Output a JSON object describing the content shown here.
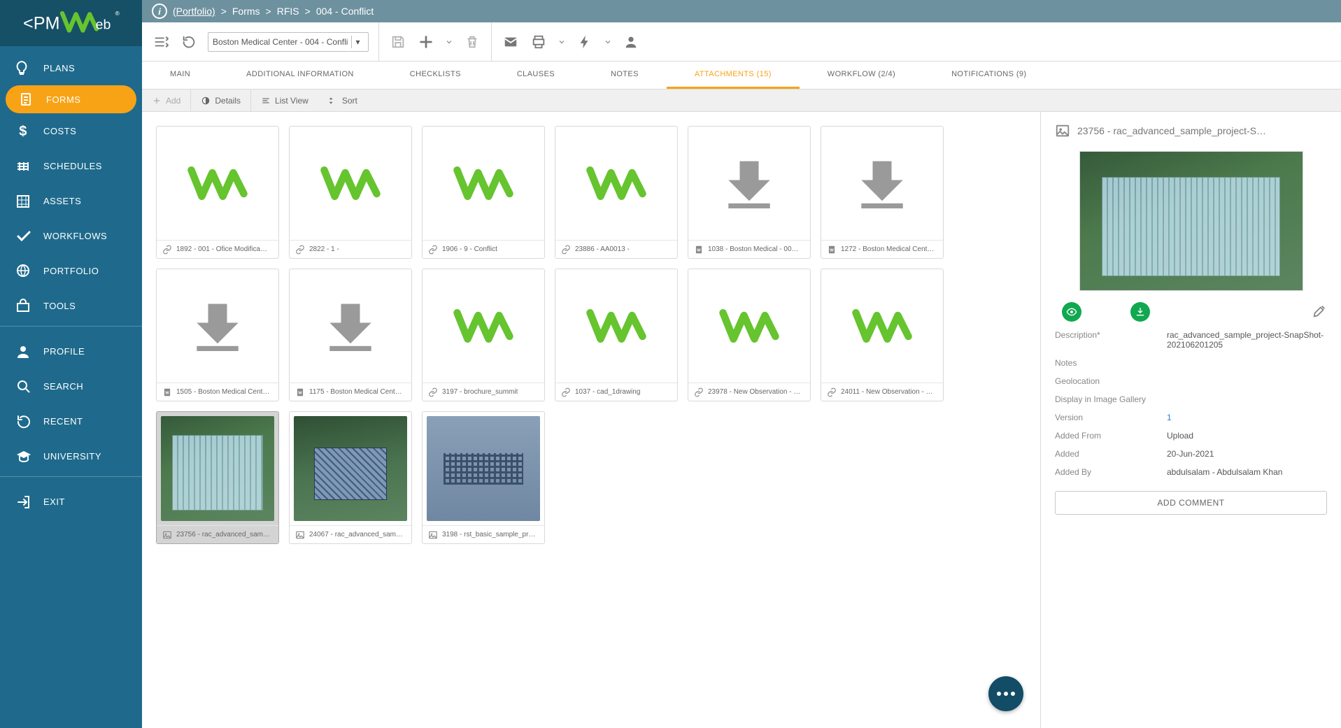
{
  "breadcrumb": {
    "root": "(Portfolio)",
    "p1": "Forms",
    "p2": "RFIS",
    "p3": "004 - Conflict"
  },
  "record_select": "Boston Medical Center - 004 - Confli",
  "nav": [
    {
      "label": "PLANS"
    },
    {
      "label": "FORMS",
      "active": true
    },
    {
      "label": "COSTS"
    },
    {
      "label": "SCHEDULES"
    },
    {
      "label": "ASSETS"
    },
    {
      "label": "WORKFLOWS"
    },
    {
      "label": "PORTFOLIO"
    },
    {
      "label": "TOOLS"
    }
  ],
  "nav2": [
    {
      "label": "PROFILE"
    },
    {
      "label": "SEARCH"
    },
    {
      "label": "RECENT"
    },
    {
      "label": "UNIVERSITY"
    }
  ],
  "nav3": [
    {
      "label": "EXIT"
    }
  ],
  "tabs": [
    {
      "label": "MAIN"
    },
    {
      "label": "ADDITIONAL INFORMATION"
    },
    {
      "label": "CHECKLISTS"
    },
    {
      "label": "CLAUSES"
    },
    {
      "label": "NOTES"
    },
    {
      "label": "ATTACHMENTS (15)",
      "active": true
    },
    {
      "label": "WORKFLOW (2/4)"
    },
    {
      "label": "NOTIFICATIONS (9)"
    }
  ],
  "subbar": {
    "add": "Add",
    "details": "Details",
    "list": "List View",
    "sort": "Sort"
  },
  "cards": [
    {
      "label": "1892 - 001 - Ofice Modifica…",
      "type": "link",
      "thumb": "w"
    },
    {
      "label": "2822 - 1 -",
      "type": "link",
      "thumb": "w"
    },
    {
      "label": "1906 - 9 - Conflict",
      "type": "link",
      "thumb": "w"
    },
    {
      "label": "23886 - AA0013 -",
      "type": "link",
      "thumb": "w"
    },
    {
      "label": "1038 - Boston Medical - 00…",
      "type": "doc",
      "thumb": "dl"
    },
    {
      "label": "1272 - Boston Medical Cent…",
      "type": "doc",
      "thumb": "dl"
    },
    {
      "label": "1505 - Boston Medical Cent…",
      "type": "doc",
      "thumb": "dl"
    },
    {
      "label": "1175 - Boston Medical Cent…",
      "type": "doc",
      "thumb": "dl"
    },
    {
      "label": "3197 - brochure_summit",
      "type": "link",
      "thumb": "w"
    },
    {
      "label": "1037 - cad_1drawing",
      "type": "link",
      "thumb": "w"
    },
    {
      "label": "23978 - New Observation - …",
      "type": "link",
      "thumb": "w"
    },
    {
      "label": "24011 - New Observation - …",
      "type": "link",
      "thumb": "w"
    },
    {
      "label": "23756 - rac_advanced_sam…",
      "type": "img",
      "thumb": "b1",
      "selected": true
    },
    {
      "label": "24067 - rac_advanced_sam…",
      "type": "img",
      "thumb": "b2"
    },
    {
      "label": "3198 - rst_basic_sample_pr…",
      "type": "img",
      "thumb": "b3"
    }
  ],
  "details": {
    "title": "23756 - rac_advanced_sample_project-S…",
    "rows": {
      "description_k": "Description*",
      "description_v": "rac_advanced_sample_project-SnapShot-202106201205",
      "notes_k": "Notes",
      "notes_v": "",
      "geo_k": "Geolocation",
      "geo_v": "",
      "gallery_k": "Display in Image Gallery",
      "version_k": "Version",
      "version_v": "1",
      "addedfrom_k": "Added From",
      "addedfrom_v": "Upload",
      "added_k": "Added",
      "added_v": "20-Jun-2021",
      "addedby_k": "Added By",
      "addedby_v": "abdulsalam - Abdulsalam Khan"
    },
    "add_comment": "ADD COMMENT"
  }
}
